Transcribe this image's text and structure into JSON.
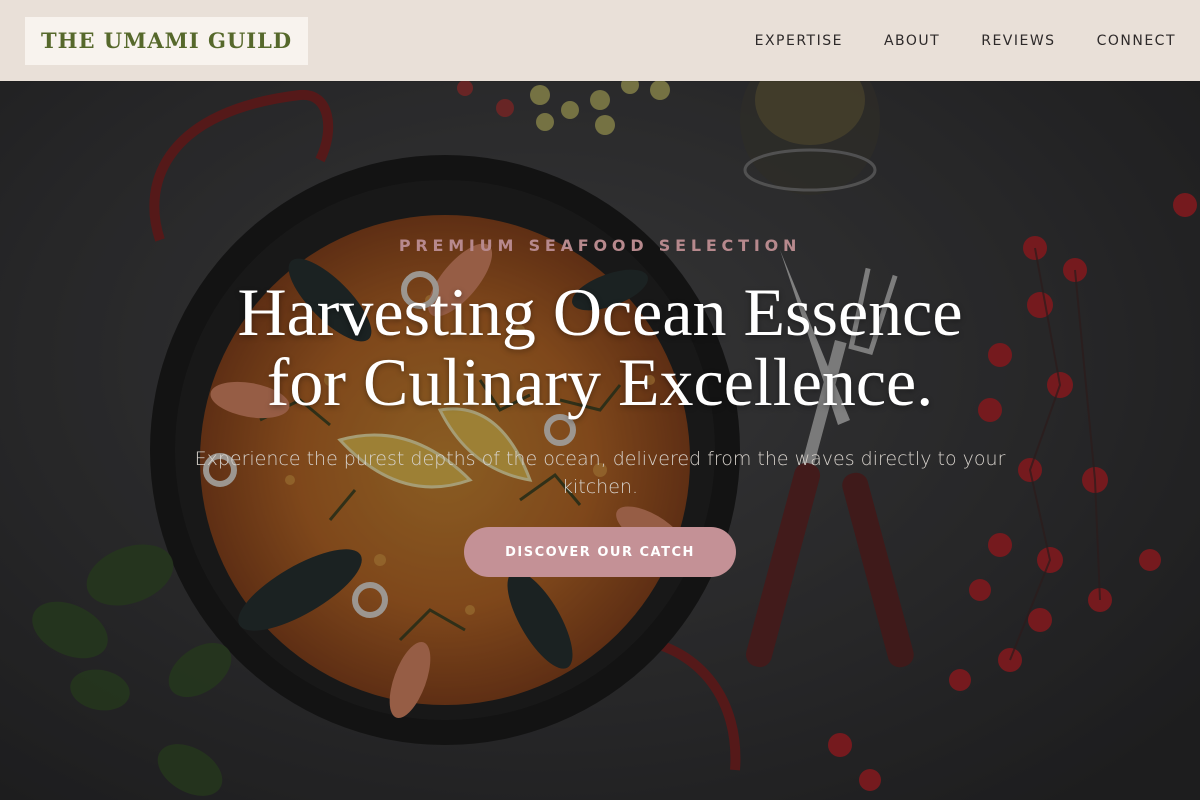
{
  "brand": {
    "name": "THE UMAMI GUILD"
  },
  "nav": {
    "items": [
      {
        "label": "EXPERTISE"
      },
      {
        "label": "ABOUT"
      },
      {
        "label": "REVIEWS"
      },
      {
        "label": "CONNECT"
      }
    ]
  },
  "hero": {
    "eyebrow": "PREMIUM SEAFOOD SELECTION",
    "title_line1": "Harvesting Ocean Essence",
    "title_line2": "for Culinary Excellence.",
    "subtitle": "Experience the purest depths of the ocean, delivered from the waves directly to your kitchen.",
    "cta_label": "DISCOVER OUR CATCH"
  },
  "colors": {
    "header_bg": "#e9e0d8",
    "logo_text": "#56682b",
    "eyebrow": "#b7898d",
    "cta_bg": "#c49196",
    "hero_text": "#ffffff"
  },
  "background_image": {
    "subject": "paella pan with seafood, lemon wedges, mussels and shrimp on dark slate, with knife and fork, red berries, grapes and wine glass"
  }
}
